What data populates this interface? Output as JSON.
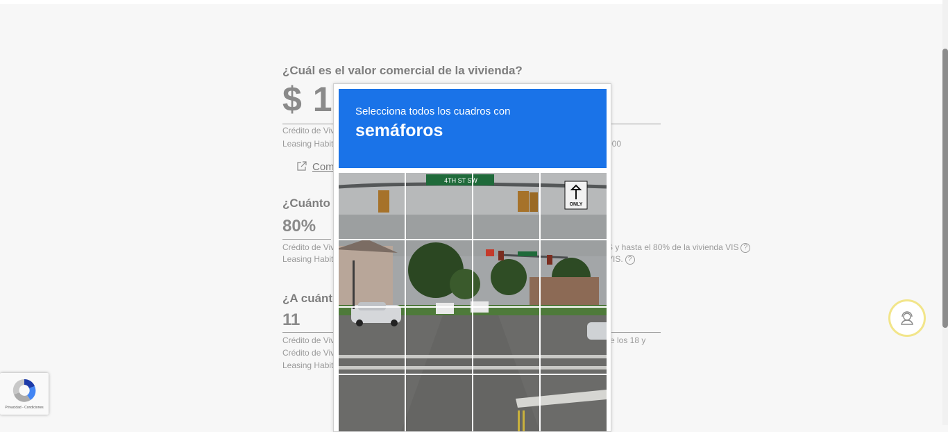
{
  "form": {
    "q1": "¿Cuál es el valor comercial de la vivienda?",
    "q1_value": "$ 1",
    "q1_notes": [
      "Crédito de Viv",
      "Leasing Habit"
    ],
    "q1_note_right": "000",
    "compare_link": "Com",
    "q2": "¿Cuánto d",
    "q2_value": "80%",
    "q2_notes": [
      "Crédito de Viv",
      "Leasing Habit"
    ],
    "q2_note_right1": "S y hasta el 80% de la vivienda VIS",
    "q2_note_right2": "VIS.",
    "q3": "¿A cuánto",
    "q3_value": "11",
    "q3_notes": [
      "Crédito de Viv",
      "Crédito de Viv",
      "Leasing Habit"
    ],
    "q3_note_right": "re los 18 y"
  },
  "captcha": {
    "instruction": "Selecciona todos los cuadros con",
    "object": "semáforos",
    "street_sign": "4TH ST SW",
    "turn_sign": "ONLY"
  },
  "badge": {
    "footer": "Privacidad - Condiciones"
  },
  "icons": {
    "help": "question-circle-icon",
    "external": "external-link-icon",
    "support": "support-agent-icon",
    "recaptcha": "recaptcha-logo-icon"
  },
  "colors": {
    "captcha_blue": "#1a73e8",
    "support_ring": "#f2e58a"
  }
}
